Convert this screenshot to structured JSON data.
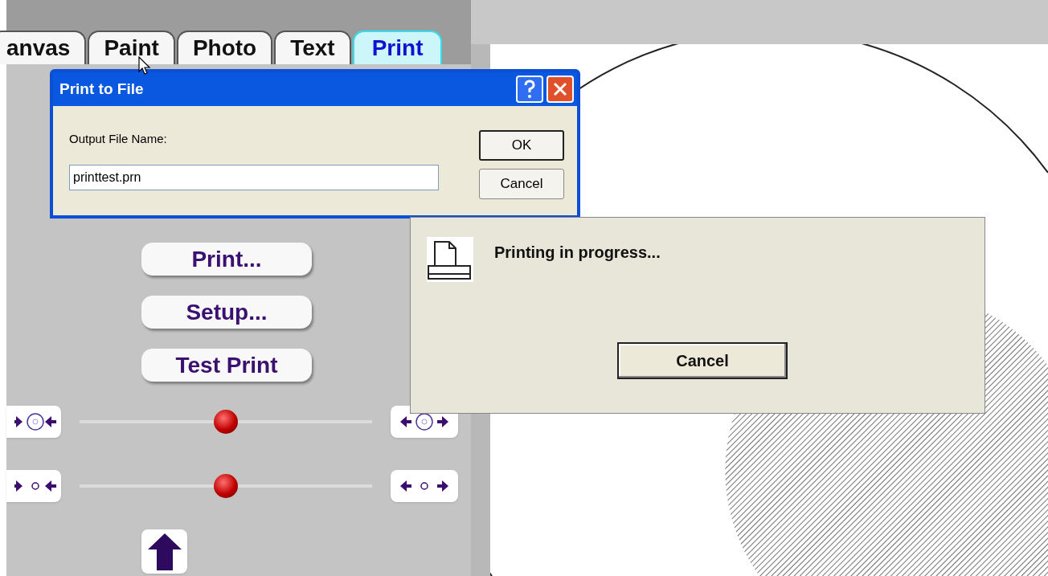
{
  "tabs": [
    {
      "label": "anvas",
      "selected": false
    },
    {
      "label": "Paint",
      "selected": false
    },
    {
      "label": "Photo",
      "selected": false
    },
    {
      "label": "Text",
      "selected": false
    },
    {
      "label": "Print",
      "selected": true
    }
  ],
  "actions": [
    "Print...",
    "Setup...",
    "Test Print"
  ],
  "sliders": [
    {
      "kind": "disc",
      "level": 0.5
    },
    {
      "kind": "dot",
      "level": 0.5
    }
  ],
  "print_to_file_dialog": {
    "title": "Print to File",
    "field_label": "Output File Name:",
    "file_name": "printtest.prn",
    "buttons": [
      "OK",
      "Cancel"
    ]
  },
  "progress_dialog": {
    "message": "Printing in progress...",
    "button": "Cancel"
  }
}
